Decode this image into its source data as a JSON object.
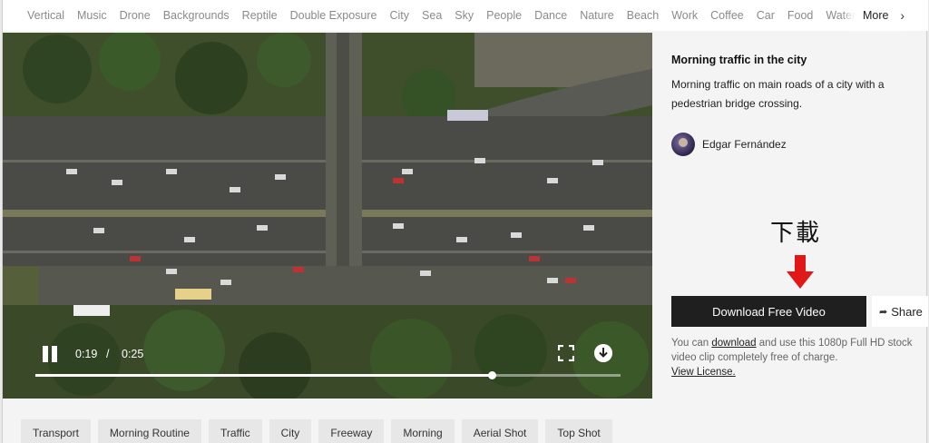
{
  "categories": [
    "Vertical",
    "Music",
    "Drone",
    "Backgrounds",
    "Reptile",
    "Double Exposure",
    "City",
    "Sea",
    "Sky",
    "People",
    "Dance",
    "Nature",
    "Beach",
    "Work",
    "Coffee",
    "Car",
    "Food",
    "Water"
  ],
  "more_label": "More",
  "player": {
    "current_time": "0:19",
    "separator": "/",
    "duration": "0:25",
    "progress_fraction": 0.78
  },
  "video": {
    "title": "Morning traffic in the city",
    "description": "Morning traffic on main roads of a city with a pedestrian bridge crossing.",
    "author": "Edgar Fernández"
  },
  "annotation": {
    "text": "下載",
    "arrow_color": "#e01818"
  },
  "download": {
    "button_label": "Download Free Video",
    "share_label": "Share",
    "license_prefix": "You can ",
    "license_link": "download",
    "license_suffix": " and use this 1080p Full HD stock video clip completely free of charge.",
    "view_license": "View License."
  },
  "tags": [
    "Transport",
    "Morning Routine",
    "Traffic",
    "City",
    "Freeway",
    "Morning",
    "Aerial Shot",
    "Top Shot"
  ],
  "colors": {
    "download_button_bg": "#1f1f1f",
    "annotation_arrow": "#e01818"
  }
}
